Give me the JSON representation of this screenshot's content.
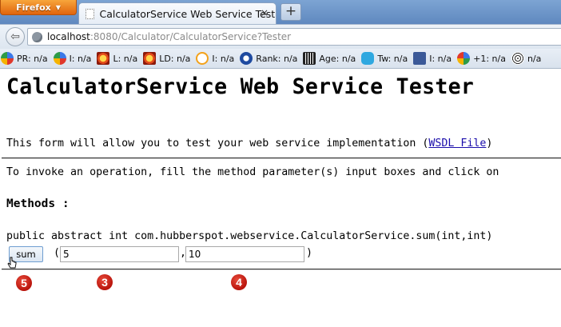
{
  "browser": {
    "app_button_label": "Firefox",
    "tab_title": "CalculatorService Web Service Tester",
    "tab_close_label": "×",
    "new_tab_label": "+",
    "url_host": "localhost",
    "url_rest": ":8080/Calculator/CalculatorService?Tester"
  },
  "extension_toolbar": {
    "items": [
      {
        "icon": "google-icon",
        "label": "PR: n/a"
      },
      {
        "icon": "google-icon",
        "label": "I: n/a"
      },
      {
        "icon": "sun-icon",
        "label": "L: n/a"
      },
      {
        "icon": "sun-icon",
        "label": "LD: n/a"
      },
      {
        "icon": "bing-icon",
        "label": "I: n/a"
      },
      {
        "icon": "alexa-icon",
        "label": "Rank: n/a"
      },
      {
        "icon": "archive-icon",
        "label": "Age: n/a"
      },
      {
        "icon": "twitter-icon",
        "label": "Tw: n/a"
      },
      {
        "icon": "facebook-icon",
        "label": "I: n/a"
      },
      {
        "icon": "google-plus-icon",
        "label": "+1: n/a"
      },
      {
        "icon": "fingerprint-icon",
        "label": "n/a"
      }
    ]
  },
  "page": {
    "title": "CalculatorService Web Service Tester",
    "intro_text": "This form will allow you to test your web service implementation (",
    "wsdl_link": "WSDL File",
    "intro_close": ")",
    "invoke_text": "To invoke an operation, fill the method parameter(s) input boxes and click on",
    "methods_heading": "Methods :",
    "method_signature": "public abstract int com.hubberspot.webservice.CalculatorService.sum(int,int)",
    "sum_button_label": "sum",
    "open_paren": "(",
    "comma": ",",
    "close_paren": ")",
    "param1_value": "5",
    "param2_value": "10"
  },
  "annotations": {
    "badge_sum": "5",
    "badge_param1": "3",
    "badge_param2": "4"
  }
}
